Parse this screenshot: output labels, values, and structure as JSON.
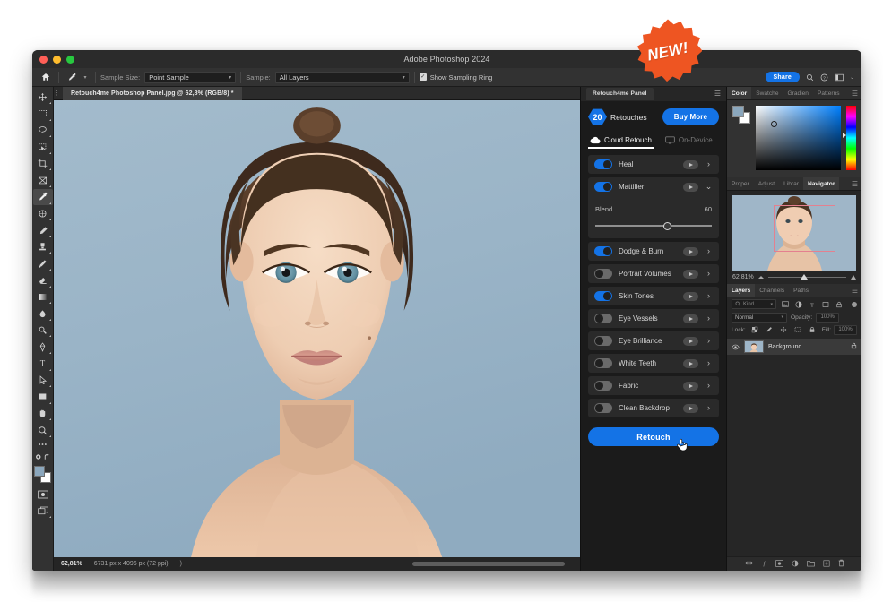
{
  "window": {
    "title": "Adobe Photoshop 2024"
  },
  "badge": {
    "label": "NEW!"
  },
  "options_bar": {
    "home_icon": "home-icon",
    "tool_icon": "eyedropper-icon",
    "sample_size_label": "Sample Size:",
    "sample_size_value": "Point Sample",
    "sample_label": "Sample:",
    "sample_value": "All Layers",
    "show_sampling_ring": "Show Sampling Ring",
    "share_label": "Share",
    "icons": [
      "search-icon",
      "help-icon",
      "workspace-icon",
      "chevron-down-icon"
    ]
  },
  "document": {
    "tab_title": "Retouch4me Photoshop Panel.jpg @ 62,8% (RGB/8) *"
  },
  "status_bar": {
    "zoom": "62,81%",
    "dimensions": "6731 px x 4096 px (72 ppi)",
    "arrow": ")"
  },
  "toolbar": {
    "tools": [
      {
        "name": "move-tool",
        "active": false
      },
      {
        "name": "rectangular-marquee-tool",
        "active": false
      },
      {
        "name": "lasso-tool",
        "active": false
      },
      {
        "name": "object-selection-tool",
        "active": false
      },
      {
        "name": "crop-tool",
        "active": false
      },
      {
        "name": "frame-tool",
        "active": false
      },
      {
        "name": "eyedropper-tool",
        "active": true
      },
      {
        "name": "spot-healing-brush-tool",
        "active": false
      },
      {
        "name": "brush-tool",
        "active": false
      },
      {
        "name": "clone-stamp-tool",
        "active": false
      },
      {
        "name": "history-brush-tool",
        "active": false
      },
      {
        "name": "eraser-tool",
        "active": false
      },
      {
        "name": "gradient-tool",
        "active": false
      },
      {
        "name": "blur-tool",
        "active": false
      },
      {
        "name": "dodge-tool",
        "active": false
      },
      {
        "name": "pen-tool",
        "active": false
      },
      {
        "name": "type-tool",
        "active": false
      },
      {
        "name": "path-selection-tool",
        "active": false
      },
      {
        "name": "rectangle-tool",
        "active": false
      },
      {
        "name": "hand-tool",
        "active": false
      },
      {
        "name": "zoom-tool",
        "active": false
      },
      {
        "name": "edit-toolbar-tool",
        "active": false
      }
    ]
  },
  "retouch_panel": {
    "tab_label": "Retouch4me Panel",
    "menu_icon": "hamburger-icon",
    "retouch_count": "20",
    "retouch_count_label": "Retouches",
    "buy_more_label": "Buy More",
    "modes": [
      {
        "label": "Cloud Retouch",
        "icon": "cloud-icon",
        "selected": true
      },
      {
        "label": "On-Device",
        "icon": "monitor-icon",
        "selected": false
      }
    ],
    "features": [
      {
        "name": "Heal",
        "enabled": true,
        "expanded": false
      },
      {
        "name": "Mattifier",
        "enabled": true,
        "expanded": true,
        "slider_label": "Blend",
        "slider_value": "60"
      },
      {
        "name": "Dodge & Burn",
        "enabled": true,
        "expanded": false
      },
      {
        "name": "Portrait Volumes",
        "enabled": false,
        "expanded": false
      },
      {
        "name": "Skin Tones",
        "enabled": true,
        "expanded": false
      },
      {
        "name": "Eye Vessels",
        "enabled": false,
        "expanded": false
      },
      {
        "name": "Eye Brilliance",
        "enabled": false,
        "expanded": false
      },
      {
        "name": "White Teeth",
        "enabled": false,
        "expanded": false
      },
      {
        "name": "Fabric",
        "enabled": false,
        "expanded": false
      },
      {
        "name": "Clean Backdrop",
        "enabled": false,
        "expanded": false
      }
    ],
    "action_button": "Retouch",
    "cursor_icon": "pointing-hand-cursor"
  },
  "color_panel": {
    "tabs": [
      "Color",
      "Swatche",
      "Gradien",
      "Patterns"
    ],
    "selected_tab": "Color",
    "menu_icon": "hamburger-icon",
    "foreground_color": "#8ba7bd",
    "background_color": "#ffffff"
  },
  "navigator_panel": {
    "tabs": [
      "Proper",
      "Adjust",
      "Librar",
      "Navigator"
    ],
    "selected_tab": "Navigator",
    "menu_icon": "hamburger-icon",
    "zoom": "62,81%",
    "view_box_color": "#e4808f"
  },
  "layers_panel": {
    "tabs": [
      "Layers",
      "Channels",
      "Paths"
    ],
    "selected_tab": "Layers",
    "menu_icon": "hamburger-icon",
    "filter_placeholder": "Kind",
    "filter_icons": [
      "image-filter-icon",
      "adjustment-filter-icon",
      "type-filter-icon",
      "shape-filter-icon",
      "smart-object-filter-icon"
    ],
    "blend_mode": "Normal",
    "opacity_label": "Opacity:",
    "opacity_value": "100%",
    "lock_label": "Lock:",
    "lock_icons": [
      "lock-transparency-icon",
      "lock-image-icon",
      "lock-position-icon",
      "lock-artboard-icon",
      "lock-all-icon"
    ],
    "fill_label": "Fill:",
    "fill_value": "100%",
    "rows": [
      {
        "name": "Background",
        "visible": true,
        "locked": true
      }
    ],
    "bottom_icons": [
      "link-layers-icon",
      "layer-style-icon",
      "layer-mask-icon",
      "adjustment-layer-icon",
      "new-group-icon",
      "new-layer-icon",
      "delete-layer-icon"
    ]
  },
  "colors": {
    "accent_blue": "#1473e6",
    "badge_orange": "#ee5522",
    "panel_bg": "#1b1b1b",
    "app_bg": "#1e1e1e"
  }
}
